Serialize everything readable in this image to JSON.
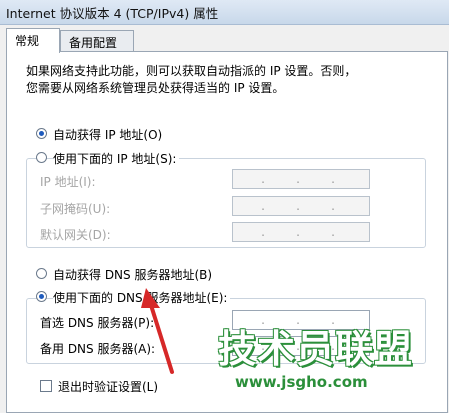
{
  "window": {
    "title": "Internet 协议版本 4 (TCP/IPv4) 属性"
  },
  "tabs": [
    {
      "label": "常规",
      "active": true
    },
    {
      "label": "备用配置",
      "active": false
    }
  ],
  "description": "如果网络支持此功能，则可以获取自动指派的 IP 设置。否则，\n您需要从网络系统管理员处获得适当的 IP 设置。",
  "ip": {
    "auto_label": "自动获得 IP 地址(O)",
    "manual_label": "使用下面的 IP 地址(S):",
    "selected": "auto",
    "fields": [
      {
        "label": "IP 地址(I):"
      },
      {
        "label": "子网掩码(U):"
      },
      {
        "label": "默认网关(D):"
      }
    ]
  },
  "dns": {
    "auto_label": "自动获得 DNS 服务器地址(B)",
    "manual_label": "使用下面的 DNS 服务器地址(E):",
    "selected": "manual",
    "fields": [
      {
        "label": "首选 DNS 服务器(P):"
      },
      {
        "label": "备用 DNS 服务器(A):"
      }
    ]
  },
  "validate_label": "退出时验证设置(L)",
  "watermark": {
    "brand": "技术员联盟",
    "url": "www.jsgho.com"
  },
  "colors": {
    "arrow": "#d62828",
    "watermark_green": "#2b8f3a",
    "radio_dot": "#1e5bbd"
  }
}
